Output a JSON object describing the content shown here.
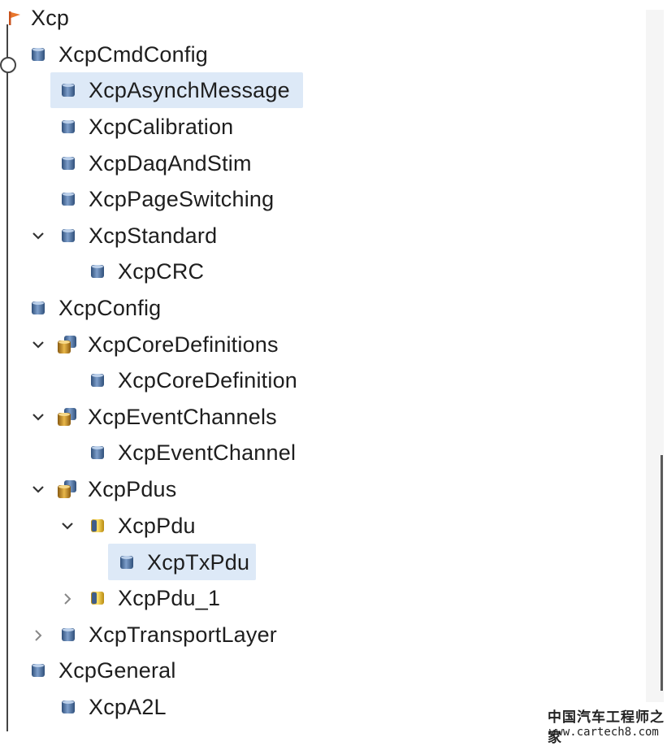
{
  "tree": {
    "root_label": "Xcp",
    "items": [
      {
        "label": "XcpCmdConfig"
      },
      {
        "label": "XcpAsynchMessage"
      },
      {
        "label": "XcpCalibration"
      },
      {
        "label": "XcpDaqAndStim"
      },
      {
        "label": "XcpPageSwitching"
      },
      {
        "label": "XcpStandard"
      },
      {
        "label": "XcpCRC"
      },
      {
        "label": "XcpConfig"
      },
      {
        "label": "XcpCoreDefinitions"
      },
      {
        "label": "XcpCoreDefinition"
      },
      {
        "label": "XcpEventChannels"
      },
      {
        "label": "XcpEventChannel"
      },
      {
        "label": "XcpPdus"
      },
      {
        "label": "XcpPdu"
      },
      {
        "label": "XcpTxPdu"
      },
      {
        "label": "XcpPdu_1"
      },
      {
        "label": "XcpTransportLayer"
      },
      {
        "label": "XcpGeneral"
      },
      {
        "label": "XcpA2L"
      }
    ]
  },
  "colors": {
    "selection": "#dde9f7",
    "accent": "#e8762c"
  },
  "icons": {
    "root": "module-flag-icon",
    "container": "blue-cylinder-icon",
    "list": "gold-multi-cylinder-icon",
    "element": "yellow-cylinder-icon",
    "expanded": "chevron-down-icon",
    "collapsed": "chevron-right-icon"
  },
  "watermark": {
    "text": "中国汽车工程师之家",
    "url": "www.cartech8.com"
  }
}
